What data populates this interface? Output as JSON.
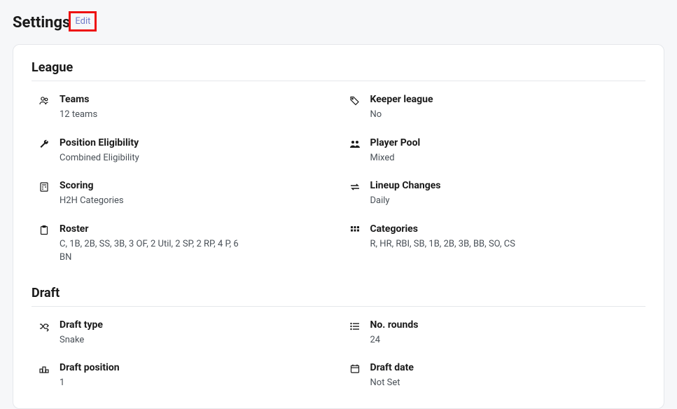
{
  "page": {
    "title": "Settings",
    "edit_label": "Edit"
  },
  "sections": {
    "league": {
      "title": "League",
      "teams": {
        "label": "Teams",
        "value": "12 teams"
      },
      "keeper": {
        "label": "Keeper league",
        "value": "No"
      },
      "eligibility": {
        "label": "Position Eligibility",
        "value": "Combined Eligibility"
      },
      "pool": {
        "label": "Player Pool",
        "value": "Mixed"
      },
      "scoring": {
        "label": "Scoring",
        "value": "H2H Categories"
      },
      "lineup": {
        "label": "Lineup Changes",
        "value": "Daily"
      },
      "roster": {
        "label": "Roster",
        "value": "C, 1B, 2B, SS, 3B, 3 OF, 2 Util, 2 SP, 2 RP, 4 P, 6 BN"
      },
      "categories": {
        "label": "Categories",
        "value": "R, HR, RBI, SB, 1B, 2B, 3B, BB, SO, CS"
      }
    },
    "draft": {
      "title": "Draft",
      "type": {
        "label": "Draft type",
        "value": "Snake"
      },
      "rounds": {
        "label": "No. rounds",
        "value": "24"
      },
      "position": {
        "label": "Draft position",
        "value": "1"
      },
      "date": {
        "label": "Draft date",
        "value": "Not Set"
      }
    }
  }
}
